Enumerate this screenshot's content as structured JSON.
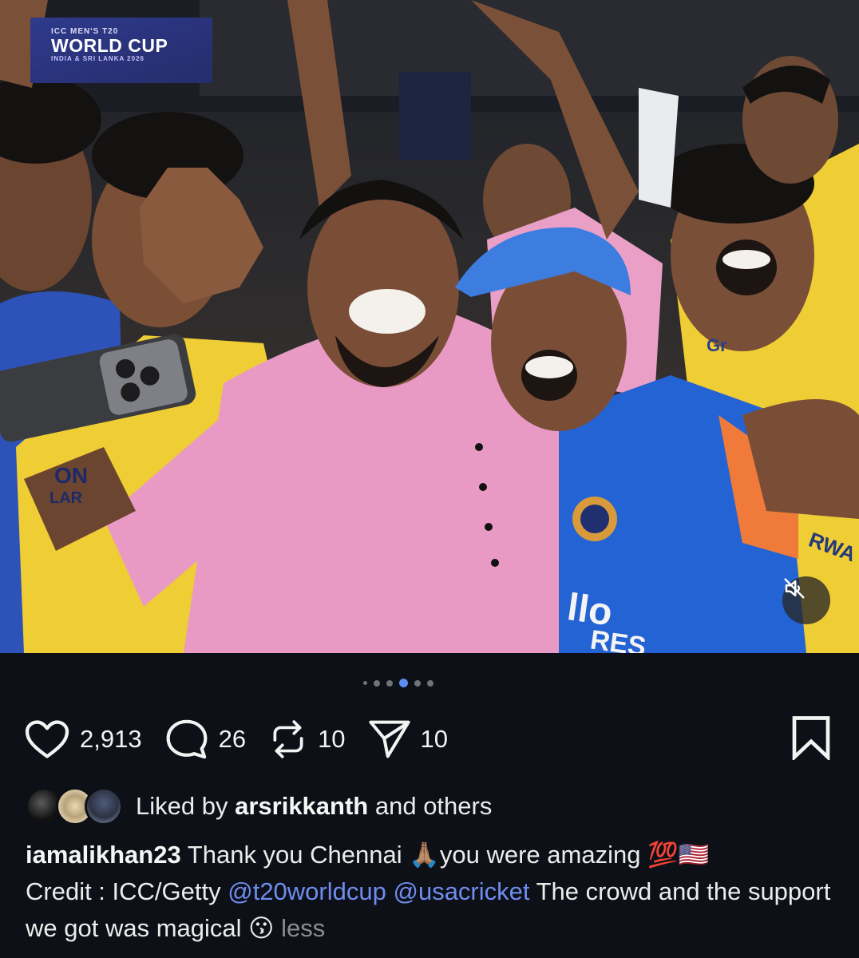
{
  "banner": {
    "line1": "ICC MEN'S T20",
    "line2": "WORLD CUP",
    "line3": "INDIA & SRI LANKA 2026"
  },
  "photo": {
    "jersey_texts": [
      "ON",
      "LAR",
      "llo",
      "RES",
      "RWA",
      "Gr"
    ]
  },
  "carousel": {
    "total": 6,
    "active_index": 3
  },
  "actions": {
    "likes": "2,913",
    "comments": "26",
    "reposts": "10",
    "shares": "10"
  },
  "liked_by": {
    "prefix": "Liked by",
    "user": "arsrikkanth",
    "suffix": "and others"
  },
  "caption": {
    "username": "iamalikhan23",
    "text1": "Thank you Chennai",
    "emoji1": "🙏🏽",
    "text2": "you were amazing",
    "emoji2": "💯🇺🇸",
    "text3": "Credit : ICC/Getty",
    "mention1": "@t20worldcup",
    "mention2": "@usacricket",
    "text4": "The crowd and the support we got was magical",
    "emoji3": "😗",
    "less": "less"
  },
  "colors": {
    "background": "#0d1017",
    "mention": "#6f8df0",
    "active_dot": "#5a8cf5",
    "pink_shirt": "#e99ac4",
    "yellow_jersey": "#f2d23a",
    "blue_jersey": "#1f5fd0"
  },
  "icons": {
    "like": "heart-icon",
    "comment": "comment-icon",
    "repost": "repost-icon",
    "share": "send-icon",
    "save": "bookmark-icon",
    "mute": "speaker-muted-icon"
  }
}
